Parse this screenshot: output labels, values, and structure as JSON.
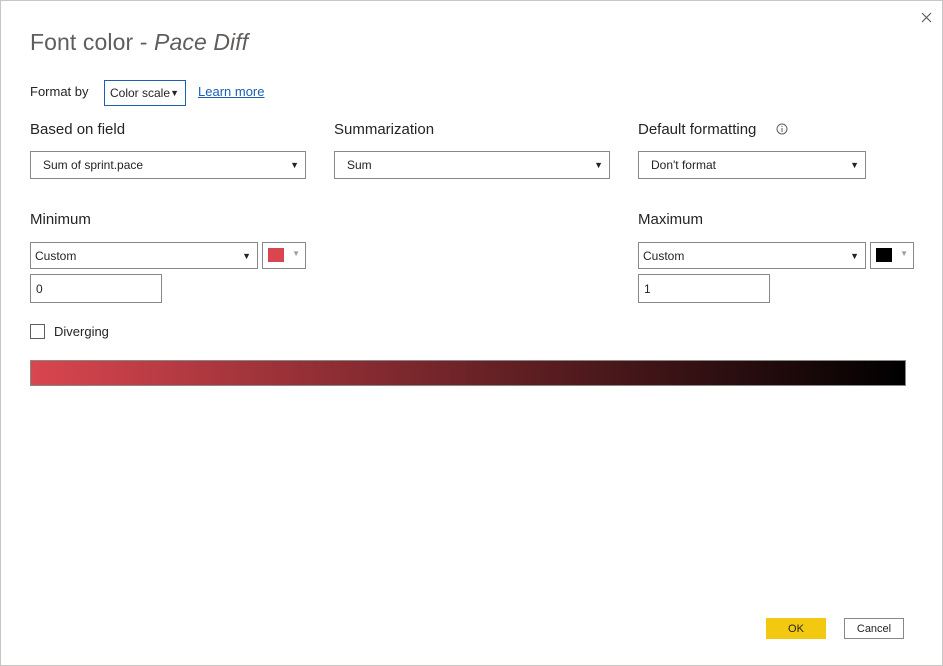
{
  "dialog": {
    "title_prefix": "Font color - ",
    "title_measure": "Pace Diff",
    "close_icon": "close-icon"
  },
  "format_by": {
    "label": "Format by",
    "value": "Color scale",
    "learn_more": "Learn more"
  },
  "based_on_field": {
    "label": "Based on field",
    "value": "Sum of sprint.pace"
  },
  "summarization": {
    "label": "Summarization",
    "value": "Sum"
  },
  "default_formatting": {
    "label": "Default formatting",
    "value": "Don't format",
    "info_icon": "info-icon"
  },
  "minimum": {
    "label": "Minimum",
    "type": "Custom",
    "value": "0",
    "color": "#d9464f"
  },
  "maximum": {
    "label": "Maximum",
    "type": "Custom",
    "value": "1",
    "color": "#000000"
  },
  "diverging": {
    "label": "Diverging",
    "checked": false
  },
  "gradient": {
    "from": "#d9464f",
    "to": "#000000"
  },
  "buttons": {
    "ok": "OK",
    "cancel": "Cancel",
    "ok_color": "#f2c811"
  }
}
